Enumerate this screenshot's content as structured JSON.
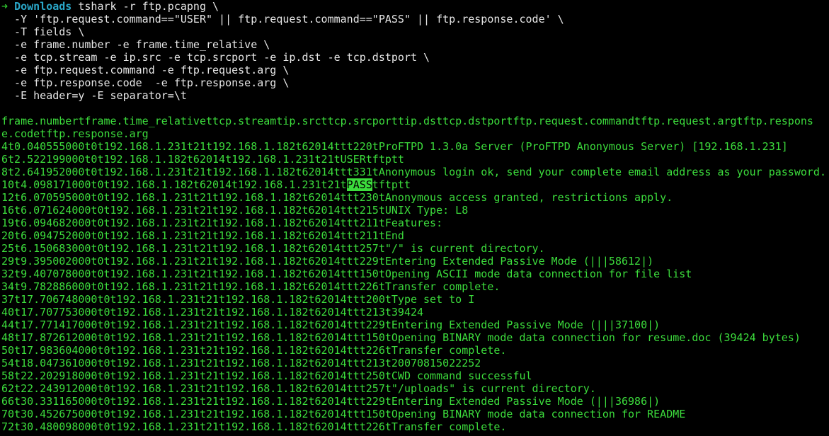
{
  "prompt": {
    "arrow": "➜",
    "directory": "Downloads",
    "command": "tshark -r ftp.pcapng \\"
  },
  "command_lines": [
    "  -Y 'ftp.request.command==\"USER\" || ftp.request.command==\"PASS\" || ftp.response.code' \\",
    "  -T fields \\",
    "  -e frame.number -e frame.time_relative \\",
    "  -e tcp.stream -e ip.src -e tcp.srcport -e ip.dst -e tcp.dstport \\",
    "  -e ftp.request.command -e ftp.request.arg \\",
    "  -e ftp.response.code  -e ftp.response.arg \\",
    "  -E header=y -E separator=\\t"
  ],
  "output_header": [
    "frame.numbertframe.time_relativettcp.streamtip.srcttcp.srcporttip.dsttcp.dstportftp.request.commandtftp.request.argtftp.respons",
    "e.codetftp.response.arg"
  ],
  "output_lines": [
    "4t0.040555000t0t192.168.1.231t21t192.168.1.182t62014ttt220tProFTPD 1.3.0a Server (ProFTPD Anonymous Server) [192.168.1.231]",
    "6t2.522199000t0t192.168.1.182t62014t192.168.1.231t21tUSERtftptt",
    "8t2.641952000t0t192.168.1.231t21t192.168.1.182t62014ttt331tAnonymous login ok, send your complete email address as your password.",
    "12t6.070595000t0t192.168.1.231t21t192.168.1.182t62014ttt230tAnonymous access granted, restrictions apply.",
    "16t6.071624000t0t192.168.1.231t21t192.168.1.182t62014ttt215tUNIX Type: L8",
    "19t6.094682000t0t192.168.1.231t21t192.168.1.182t62014ttt211tFeatures:",
    "20t6.094752000t0t192.168.1.231t21t192.168.1.182t62014ttt211tEnd",
    "25t6.150683000t0t192.168.1.231t21t192.168.1.182t62014ttt257t\"/\" is current directory.",
    "29t9.395002000t0t192.168.1.231t21t192.168.1.182t62014ttt229tEntering Extended Passive Mode (|||58612|)",
    "32t9.407078000t0t192.168.1.231t21t192.168.1.182t62014ttt150tOpening ASCII mode data connection for file list",
    "34t9.782886000t0t192.168.1.231t21t192.168.1.182t62014ttt226tTransfer complete.",
    "37t17.706748000t0t192.168.1.231t21t192.168.1.182t62014ttt200tType set to I",
    "40t17.707753000t0t192.168.1.231t21t192.168.1.182t62014ttt213t39424",
    "44t17.771417000t0t192.168.1.231t21t192.168.1.182t62014ttt229tEntering Extended Passive Mode (|||37100|)",
    "48t17.872612000t0t192.168.1.231t21t192.168.1.182t62014ttt150tOpening BINARY mode data connection for resume.doc (39424 bytes)",
    "50t17.983604000t0t192.168.1.231t21t192.168.1.182t62014ttt226tTransfer complete.",
    "54t18.047361000t0t192.168.1.231t21t192.168.1.182t62014ttt213t20070815022252",
    "58t22.202918000t0t192.168.1.231t21t192.168.1.182t62014ttt250tCWD command successful",
    "62t22.243912000t0t192.168.1.231t21t192.168.1.182t62014ttt257t\"/uploads\" is current directory.",
    "66t30.331165000t0t192.168.1.231t21t192.168.1.182t62014ttt229tEntering Extended Passive Mode (|||36986|)",
    "70t30.452675000t0t192.168.1.231t21t192.168.1.182t62014ttt150tOpening BINARY mode data connection for README",
    "72t30.480098000t0t192.168.1.231t21t192.168.1.182t62014ttt226tTransfer complete."
  ],
  "pass_line": {
    "before": "10t4.098171000t0t192.168.1.182t62014t192.168.1.231t21t",
    "highlight": "PASS",
    "after": "tftptt"
  },
  "colors": {
    "background": "#000000",
    "output_text": "#3cdc3c",
    "prompt_arrow": "#2ec42e",
    "prompt_dir": "#2aa7c9",
    "command_text": "#e6e6e6",
    "highlight_bg": "#3cdc3c"
  }
}
